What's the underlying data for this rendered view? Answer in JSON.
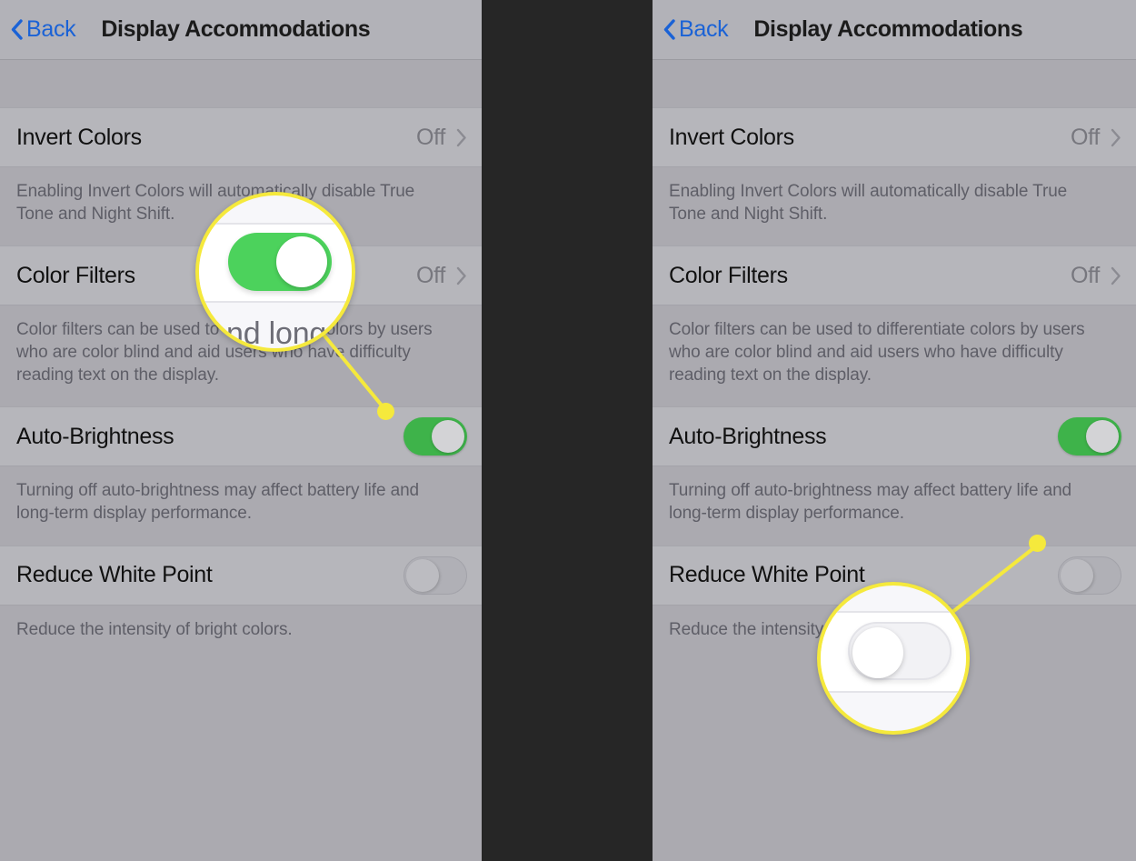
{
  "colors": {
    "panel_bg": "#abaab0",
    "row_bg": "#b6b6bb",
    "navbar_bg": "#b2b2b8",
    "gutter": "#262626",
    "accent_blue": "#1a62d6",
    "toggle_on_green": "#3eb34a",
    "callout_yellow": "#f5e93c",
    "desc_text": "#5e5e67"
  },
  "panels": [
    {
      "id": "left",
      "navbar": {
        "back_label": "Back",
        "title": "Display Accommodations",
        "back_icon": "chevron-left-icon"
      },
      "rows": [
        {
          "label": "Invert Colors",
          "control": "disclosure",
          "value": "Off",
          "chevron_icon": "chevron-right-icon",
          "description": "Enabling Invert Colors will automatically disable True Tone and Night Shift."
        },
        {
          "label": "Color Filters",
          "control": "disclosure",
          "value": "Off",
          "chevron_icon": "chevron-right-icon",
          "description": "Color filters can be used to differentiate colors by users who are color blind and aid users who have difficulty reading text on the display."
        },
        {
          "label": "Auto-Brightness",
          "control": "switch",
          "switch_state": "on",
          "description": "Turning off auto-brightness may affect battery life and long-term display performance."
        },
        {
          "label": "Reduce White Point",
          "control": "switch",
          "switch_state": "off",
          "description": "Reduce the intensity of bright colors."
        }
      ],
      "callout": {
        "target_row": "Auto-Brightness",
        "magnified_control": "switch",
        "magnified_state": "on",
        "magnified_text": "nd long"
      }
    },
    {
      "id": "right",
      "navbar": {
        "back_label": "Back",
        "title": "Display Accommodations",
        "back_icon": "chevron-left-icon"
      },
      "rows": [
        {
          "label": "Invert Colors",
          "control": "disclosure",
          "value": "Off",
          "chevron_icon": "chevron-right-icon",
          "description": "Enabling Invert Colors will automatically disable True Tone and Night Shift."
        },
        {
          "label": "Color Filters",
          "control": "disclosure",
          "value": "Off",
          "chevron_icon": "chevron-right-icon",
          "description": "Color filters can be used to differentiate colors by users who are color blind and aid users who have difficulty reading text on the display."
        },
        {
          "label": "Auto-Brightness",
          "control": "switch",
          "switch_state": "on",
          "description": "Turning off auto-brightness may affect battery life and long-term display performance."
        },
        {
          "label": "Reduce White Point",
          "control": "switch",
          "switch_state": "off",
          "description": "Reduce the intensity of bright colors."
        }
      ],
      "callout": {
        "target_row": "Reduce White Point",
        "magnified_control": "switch",
        "magnified_state": "off",
        "magnified_text": ""
      }
    }
  ]
}
